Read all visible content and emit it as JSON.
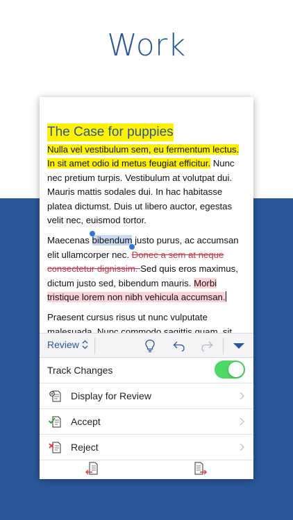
{
  "hero": {
    "title": "Work"
  },
  "document": {
    "title": "The Case for puppies",
    "p1_highlight": "Nulla vel vestibulum sem, eu fermentum lectus. In sit amet odio id metus feugiat efficitur.",
    "p1_rest": " Nunc nec pretium turpis. Vestibulum at volutpat dui. Mauris mattis sodales dui. In hac habitasse platea dictumst. Duis ut libero auctor, egestas velit nec, euismod tortor.",
    "p2_a": "Maecenas ",
    "p2_selected": "bibendum",
    "p2_b": " justo purus, ac accumsan elit ullamcorper nec. ",
    "p2_deleted": "Donec a sem at neque consectetur dignissim. ",
    "p2_c": "Sed quis eros maximus, dictum justo sed, bibendum mauris. ",
    "p2_inserted": "Morbi tristique lorem non nibh vehicula accumsan.",
    "p3": "Praesent cursus risus ut nunc vulputate malesuada. Nunc commodo sagittis quam, sit"
  },
  "toolbar": {
    "tab_label": "Review",
    "icons": [
      "lightbulb-icon",
      "undo-icon",
      "redo-icon",
      "collapse-ribbon-icon"
    ]
  },
  "review_panel": {
    "track_changes_label": "Track Changes",
    "track_changes_on": true,
    "display_for_review_label": "Display for Review",
    "accept_label": "Accept",
    "reject_label": "Reject"
  },
  "colors": {
    "brand_blue": "#2b579a",
    "highlight_yellow": "#fff200",
    "deletion_red": "#c8344a",
    "insertion_pink": "#fbd3d8",
    "toggle_green": "#4cd964"
  }
}
